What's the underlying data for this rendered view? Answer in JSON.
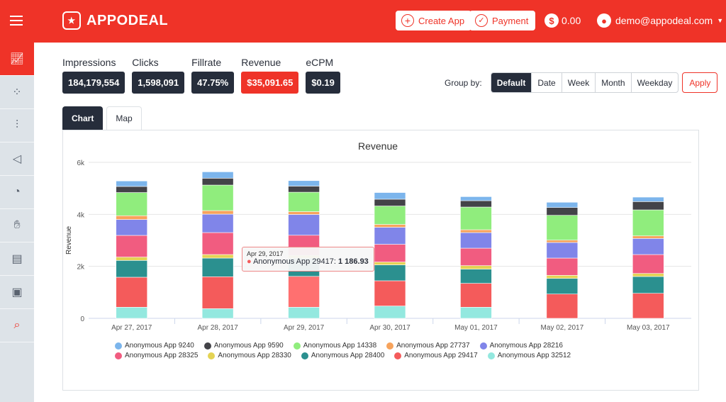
{
  "header": {
    "brand": "APPODEAL",
    "create_app": "Create App",
    "payment": "Payment",
    "balance": "0.00",
    "user": "demo@appodeal.com"
  },
  "sidebar": {
    "items": [
      {
        "icon": "line-chart-icon",
        "active": true
      },
      {
        "icon": "apps-grid-icon"
      },
      {
        "icon": "sliders-icon"
      },
      {
        "icon": "megaphone-icon"
      },
      {
        "icon": "pie-chart-icon"
      },
      {
        "icon": "hand-coins-icon"
      },
      {
        "icon": "document-icon"
      },
      {
        "icon": "image-settings-icon"
      },
      {
        "icon": "search-analytics-icon"
      }
    ]
  },
  "stats": [
    {
      "label": "Impressions",
      "value": "184,179,554"
    },
    {
      "label": "Clicks",
      "value": "1,598,091"
    },
    {
      "label": "Fillrate",
      "value": "47.75%"
    },
    {
      "label": "Revenue",
      "value": "$35,091.65"
    },
    {
      "label": "eCPM",
      "value": "$0.19"
    }
  ],
  "group_by": {
    "label": "Group by:",
    "options": [
      "Default",
      "Date",
      "Week",
      "Month",
      "Weekday"
    ],
    "selected": "Default",
    "apply": "Apply"
  },
  "tabs": [
    "Chart",
    "Map"
  ],
  "tooltip": {
    "date": "Apr 29, 2017",
    "series": "Anonymous App 29417",
    "value": "1 186.93"
  },
  "chart_data": {
    "type": "bar",
    "stacked": true,
    "title": "Revenue",
    "ylabel": "Revenue",
    "xlabel": "",
    "ylim": [
      0,
      6000
    ],
    "yticks": [
      0,
      2000,
      4000,
      6000
    ],
    "ytick_labels": [
      "0",
      "2k",
      "4k",
      "6k"
    ],
    "grid": true,
    "legend": "bottom",
    "categories": [
      "Apr 27, 2017",
      "Apr 28, 2017",
      "Apr 29, 2017",
      "Apr 30, 2017",
      "May 01, 2017",
      "May 02, 2017",
      "May 03, 2017"
    ],
    "series": [
      {
        "name": "Anonymous App 32512",
        "color": "#93e8df",
        "values": [
          428,
          374,
          428,
          475,
          428,
          0,
          0
        ]
      },
      {
        "name": "Anonymous App 29417",
        "color": "#f45b5b",
        "values": [
          1154,
          1227,
          1186.93,
          971,
          919,
          935,
          963
        ]
      },
      {
        "name": "Anonymous App 28400",
        "color": "#2b908f",
        "values": [
          646,
          717,
          700,
          611,
          545,
          600,
          646
        ]
      },
      {
        "name": "Anonymous App 28330",
        "color": "#e4d354",
        "values": [
          128,
          136,
          110,
          109,
          136,
          120,
          117
        ]
      },
      {
        "name": "Anonymous App 28325",
        "color": "#f15c80",
        "values": [
          835,
          845,
          772,
          682,
          671,
          663,
          728
        ]
      },
      {
        "name": "Anonymous App 28216",
        "color": "#8085e9",
        "values": [
          611,
          709,
          799,
          655,
          600,
          600,
          619
        ]
      },
      {
        "name": "Anonymous App 27737",
        "color": "#f7a35c",
        "values": [
          145,
          136,
          109,
          109,
          109,
          90,
          98
        ]
      },
      {
        "name": "Anonymous App 14338",
        "color": "#90ed7d",
        "values": [
          892,
          982,
          747,
          709,
          873,
          955,
          1001
        ]
      },
      {
        "name": "Anonymous App 9590",
        "color": "#434348",
        "values": [
          235,
          265,
          235,
          262,
          245,
          300,
          319
        ]
      },
      {
        "name": "Anonymous App 9240",
        "color": "#7cb5ec",
        "values": [
          210,
          245,
          210,
          256,
          155,
          202,
          172
        ]
      }
    ],
    "legend_order": [
      9,
      8,
      7,
      6,
      5,
      4,
      3,
      2,
      1,
      0
    ]
  }
}
